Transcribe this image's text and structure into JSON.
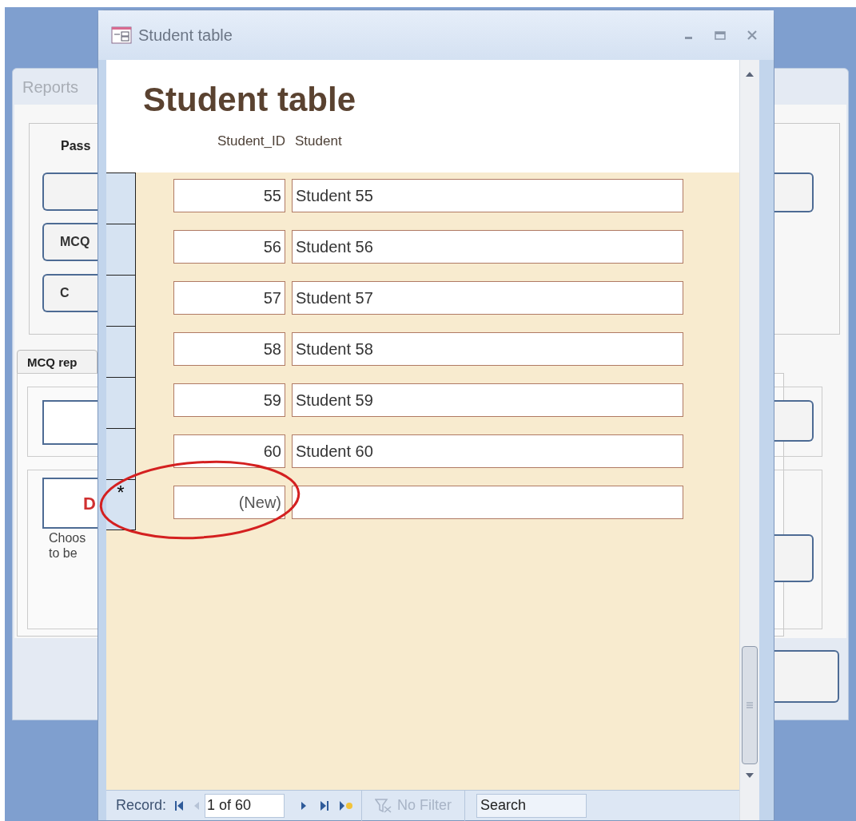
{
  "background_window": {
    "tab": "Reports",
    "group_label": "Pass",
    "buttons": [
      {
        "label": "MCQ"
      },
      {
        "label": "C"
      }
    ],
    "subtab": "MCQ rep",
    "red_button": "D",
    "note_lines": [
      "Choos",
      "to be"
    ]
  },
  "window": {
    "title": "Student table"
  },
  "form": {
    "heading": "Student table",
    "columns": [
      "Student_ID",
      "Student"
    ],
    "rows": [
      {
        "id": "55",
        "student": "Student 55"
      },
      {
        "id": "56",
        "student": "Student 56"
      },
      {
        "id": "57",
        "student": "Student 57"
      },
      {
        "id": "58",
        "student": "Student 58"
      },
      {
        "id": "59",
        "student": "Student 59"
      },
      {
        "id": "60",
        "student": "Student 60"
      }
    ],
    "new_row": {
      "marker": "*",
      "id": "(New)"
    }
  },
  "navigation": {
    "label": "Record:",
    "position": "1 of 60",
    "buttons": [
      {
        "kind": "first",
        "disabled": false
      },
      {
        "kind": "previous",
        "disabled": true
      },
      {
        "kind": "next",
        "disabled": false
      },
      {
        "kind": "last",
        "disabled": false
      },
      {
        "kind": "new",
        "disabled": false
      }
    ],
    "filter": {
      "label": "No Filter",
      "disabled": true
    },
    "search": {
      "placeholder": "Search"
    }
  }
}
